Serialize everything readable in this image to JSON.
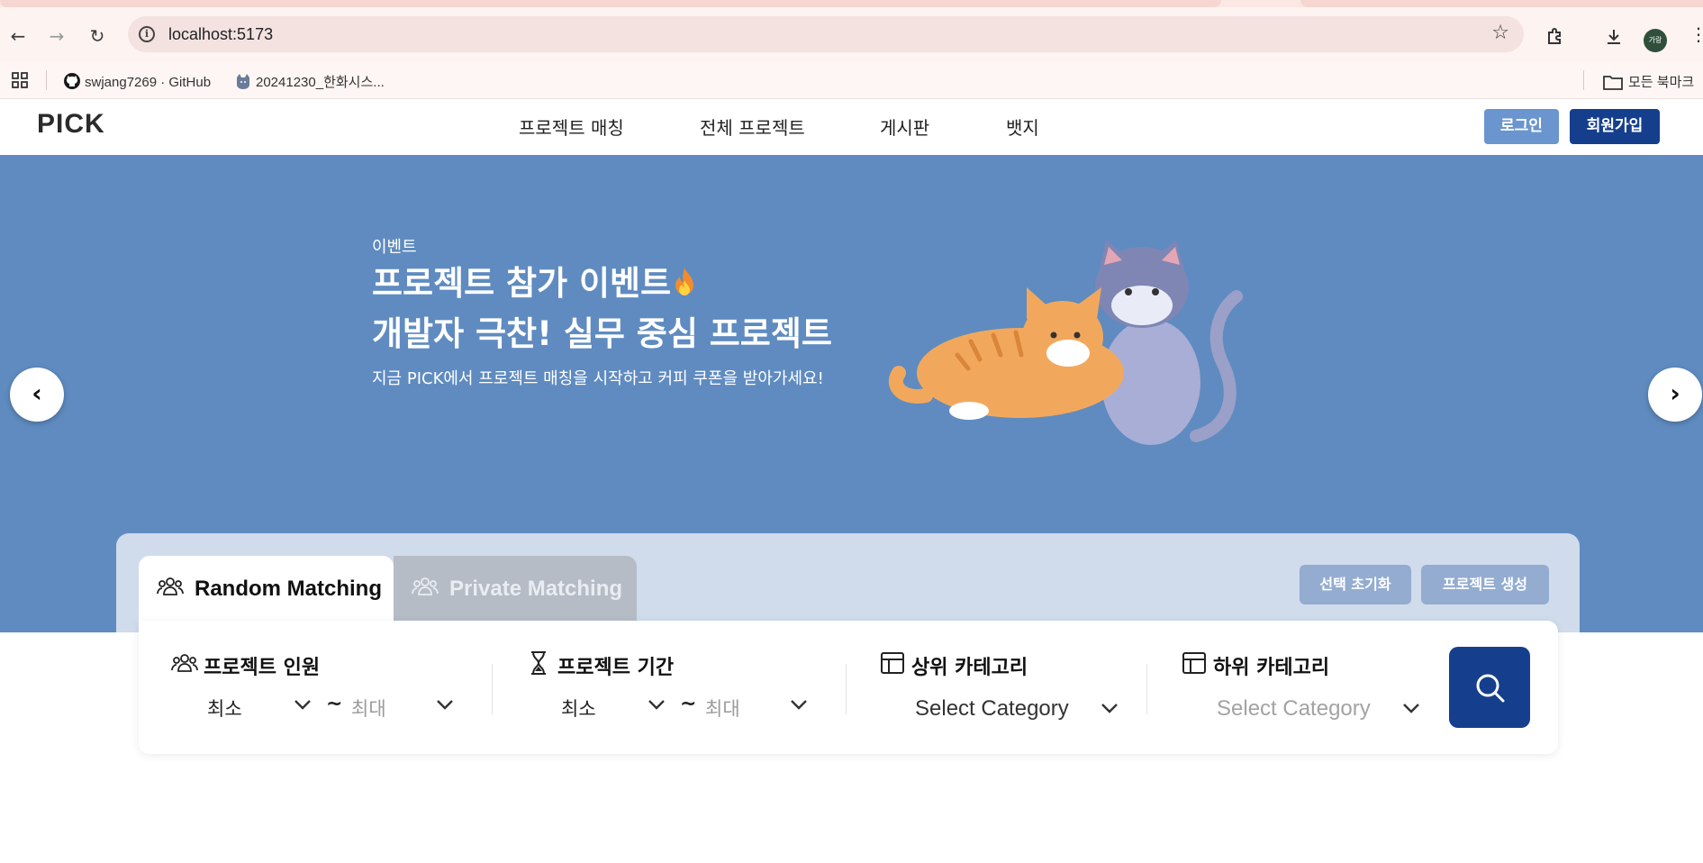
{
  "browser": {
    "url": "localhost:5173",
    "avatar_text": "가랑",
    "bookmarks": [
      {
        "label": "swjang7269 · GitHub"
      },
      {
        "label": "20241230_한화시스..."
      }
    ],
    "all_bookmarks_label": "모든 북마크"
  },
  "site": {
    "logo": "PICK",
    "nav": [
      "프로젝트 매칭",
      "전체 프로젝트",
      "게시판",
      "뱃지"
    ],
    "login_label": "로그인",
    "signup_label": "회원가입"
  },
  "hero": {
    "tag": "이벤트",
    "title_line1": "프로젝트 참가 이벤트",
    "title_line2": "개발자 극찬! 실무 중심 프로젝트",
    "description": "지금 PICK에서 프로젝트 매칭을 시작하고 커피 쿠폰을 받아가세요!",
    "background_color": "#5f8bc0"
  },
  "matching": {
    "tabs": [
      {
        "label": "Random Matching",
        "active": true
      },
      {
        "label": "Private Matching",
        "active": false
      }
    ],
    "reset_label": "선택 초기화",
    "create_label": "프로젝트 생성",
    "filters": {
      "members": {
        "title": "프로젝트 인원",
        "min": "최소",
        "max": "최대"
      },
      "duration": {
        "title": "프로젝트 기간",
        "min": "최소",
        "max": "최대"
      },
      "parent_category": {
        "title": "상위 카테고리",
        "value": "Select Category"
      },
      "child_category": {
        "title": "하위 카테고리",
        "value": "Select Category"
      }
    },
    "tilde": "~"
  },
  "colors": {
    "primary": "#153f8d",
    "accent": "#6b95cf",
    "panel": "#d0dbec"
  }
}
